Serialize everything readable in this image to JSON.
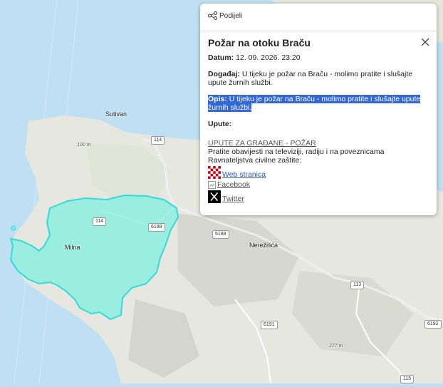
{
  "map": {
    "places": {
      "sutivan": "Sutivan",
      "milna": "Milna",
      "nerezisca": "Nerežišća"
    },
    "elevations": {
      "e100": "100 m",
      "e277": "277 m"
    },
    "roads": {
      "r114a": "114",
      "r114b": "114",
      "r6188a": "6188",
      "r6188b": "6188",
      "r113": "113",
      "r6191": "6191",
      "r6192": "6192",
      "r115": "115"
    },
    "colors": {
      "sea": "#bfe0f3",
      "land": "#e6e8df",
      "fire_area": "#7ff0e0",
      "fire_outline": "#35d9d9"
    }
  },
  "popup": {
    "share_label": "Podijeli",
    "share_icon": "share-icon",
    "title": "Požar na otoku Braču",
    "close_icon": "close-icon",
    "date_label": "Datum:",
    "date_value": "12. 09. 2026. 23:20",
    "event_label": "Događaj:",
    "event_value": "U tijeku je požar na Braču - molimo pratite i slušajte upute žurnih službi.",
    "desc_label": "Opis:",
    "desc_value": "U tijeku je požar na Braču - molimo pratite i slušajte upute žurnih službi.",
    "instructions_label": "Upute:",
    "guide_link": "UPUTE ZA GRAĐANE - POŽAR",
    "guide_text": "Pratite obavijesti na televiziji, radiju i na poveznicama Ravnateljstva civilne zaštite:",
    "links": {
      "web": "Web stranica",
      "facebook": "Facebook",
      "twitter": "Twitter"
    }
  }
}
